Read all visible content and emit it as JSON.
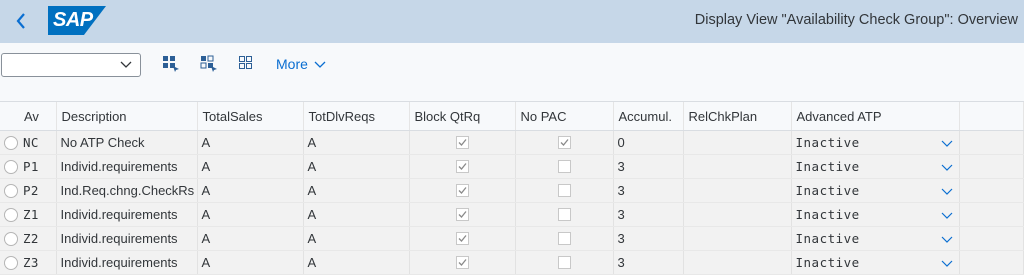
{
  "header": {
    "logo_text": "SAP",
    "title": "Display View \"Availability Check Group\": Overview"
  },
  "toolbar": {
    "select_value": "",
    "more_label": "More"
  },
  "table": {
    "columns": [
      "Av",
      "Description",
      "TotalSales",
      "TotDlvReqs",
      "Block QtRq",
      "No PAC",
      "Accumul.",
      "RelChkPlan",
      "Advanced ATP"
    ],
    "rows": [
      {
        "av": "NC",
        "description": "No ATP Check",
        "total_sales": "A",
        "tot_dlv_reqs": "A",
        "block_qtrq": true,
        "no_pac": true,
        "accumul": "0",
        "rel_chk_plan": "",
        "advanced_atp": "Inactive"
      },
      {
        "av": "P1",
        "description": "Individ.requirements",
        "total_sales": "A",
        "tot_dlv_reqs": "A",
        "block_qtrq": true,
        "no_pac": false,
        "accumul": "3",
        "rel_chk_plan": "",
        "advanced_atp": "Inactive"
      },
      {
        "av": "P2",
        "description": "Ind.Req.chng.CheckRs",
        "total_sales": "A",
        "tot_dlv_reqs": "A",
        "block_qtrq": true,
        "no_pac": false,
        "accumul": "3",
        "rel_chk_plan": "",
        "advanced_atp": "Inactive"
      },
      {
        "av": "Z1",
        "description": "Individ.requirements",
        "total_sales": "A",
        "tot_dlv_reqs": "A",
        "block_qtrq": true,
        "no_pac": false,
        "accumul": "3",
        "rel_chk_plan": "",
        "advanced_atp": "Inactive"
      },
      {
        "av": "Z2",
        "description": "Individ.requirements",
        "total_sales": "A",
        "tot_dlv_reqs": "A",
        "block_qtrq": true,
        "no_pac": false,
        "accumul": "3",
        "rel_chk_plan": "",
        "advanced_atp": "Inactive"
      },
      {
        "av": "Z3",
        "description": "Individ.requirements",
        "total_sales": "A",
        "tot_dlv_reqs": "A",
        "block_qtrq": true,
        "no_pac": false,
        "accumul": "3",
        "rel_chk_plan": "",
        "advanced_atp": "Inactive"
      }
    ]
  },
  "icons": {
    "back": "chevron-left-icon",
    "select_all": "select-all-icon",
    "select_block": "select-block-icon",
    "deselect_all": "deselect-all-icon",
    "dropdown": "chevron-down-icon",
    "checkbox_checked": "checkmark-icon"
  },
  "colors": {
    "shell": "#c6d7e8",
    "logo": "#0070c0",
    "accent": "#0a6ed1"
  }
}
